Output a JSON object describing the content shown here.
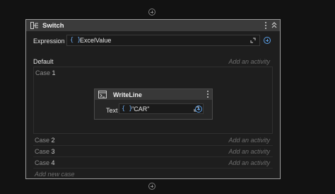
{
  "switch": {
    "title": "Switch",
    "expression_label": "Expression",
    "expression_value": "ExcelValue",
    "default_label": "Default",
    "add_activity": "Add an activity",
    "add_new_case": "Add new case"
  },
  "cases": [
    {
      "label": "Case",
      "num": "1"
    },
    {
      "label": "Case",
      "num": "2"
    },
    {
      "label": "Case",
      "num": "3"
    },
    {
      "label": "Case",
      "num": "4"
    }
  ],
  "writeline": {
    "title": "WriteLine",
    "text_label": "Text",
    "text_value": "\"CAR\""
  },
  "icons": {
    "switch": "switch-icon",
    "writeline": "writeline-icon",
    "expression": "braces-icon",
    "more": "more-options-icon",
    "collapse": "collapse-icon",
    "expand": "expand-editor-icon",
    "add": "plus-circle-icon"
  },
  "colors": {
    "accent": "#5a9ee6",
    "background": "#121212",
    "panel": "#1e1e1e",
    "header": "#3b3b3b"
  }
}
